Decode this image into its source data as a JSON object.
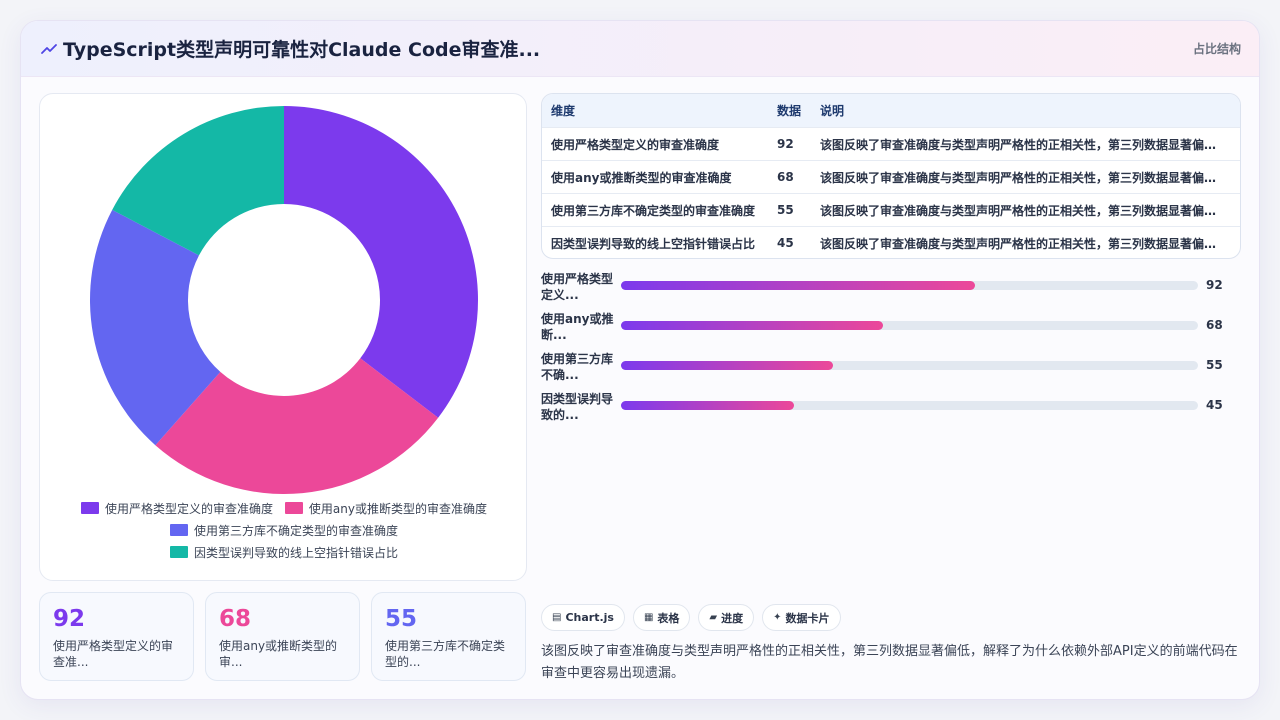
{
  "header": {
    "title": "TypeScript类型声明可靠性对Claude Code审查准...",
    "tag": "占比结构"
  },
  "chart_data": {
    "type": "pie",
    "categories": [
      "使用严格类型定义的审查准确度",
      "使用any或推断类型的审查准确度",
      "使用第三方库不确定类型的审查准确度",
      "因类型误判导致的线上空指针错误占比"
    ],
    "values": [
      92,
      68,
      55,
      45
    ],
    "colors": [
      "#7c3aed",
      "#ec4899",
      "#6366f1",
      "#14b8a6"
    ],
    "legend_position": "bottom",
    "explode": [
      false,
      false,
      false,
      false
    ]
  },
  "table": {
    "headers": [
      "维度",
      "数据",
      "说明"
    ],
    "rows": [
      {
        "name": "使用严格类型定义的审查准确度",
        "value": "92",
        "desc": "该图反映了审查准确度与类型声明严格性的正相关性，第三列数据显著偏低..."
      },
      {
        "name": "使用any或推断类型的审查准确度",
        "value": "68",
        "desc": "该图反映了审查准确度与类型声明严格性的正相关性，第三列数据显著偏低..."
      },
      {
        "name": "使用第三方库不确定类型的审查准确度",
        "value": "55",
        "desc": "该图反映了审查准确度与类型声明严格性的正相关性，第三列数据显著偏低..."
      },
      {
        "name": "因类型误判导致的线上空指针错误占比",
        "value": "45",
        "desc": "该图反映了审查准确度与类型声明严格性的正相关性，第三列数据显著偏低..."
      }
    ]
  },
  "bars": {
    "max": 150,
    "items": [
      {
        "label": "使用严格类型定义...",
        "value": 92
      },
      {
        "label": "使用any或推断...",
        "value": 68
      },
      {
        "label": "使用第三方库不确...",
        "value": 55
      },
      {
        "label": "因类型误判导致的...",
        "value": 45
      }
    ]
  },
  "stats": [
    {
      "value": "92",
      "label": "使用严格类型定义的审查准...",
      "color": "#7c3aed"
    },
    {
      "value": "68",
      "label": "使用any或推断类型的审...",
      "color": "#ec4899"
    },
    {
      "value": "55",
      "label": "使用第三方库不确定类型的...",
      "color": "#6366f1"
    }
  ],
  "chips": [
    {
      "icon": "chart-icon",
      "glyph": "▤",
      "label": "Chart.js"
    },
    {
      "icon": "table-icon",
      "glyph": "▦",
      "label": "表格"
    },
    {
      "icon": "progress-icon",
      "glyph": "▰",
      "label": "进度"
    },
    {
      "icon": "sparkle-icon",
      "glyph": "✦",
      "label": "数据卡片"
    }
  ],
  "summary": "该图反映了审查准确度与类型声明严格性的正相关性，第三列数据显著偏低，解释了为什么依赖外部API定义的前端代码在审查中更容易出现遗漏。"
}
